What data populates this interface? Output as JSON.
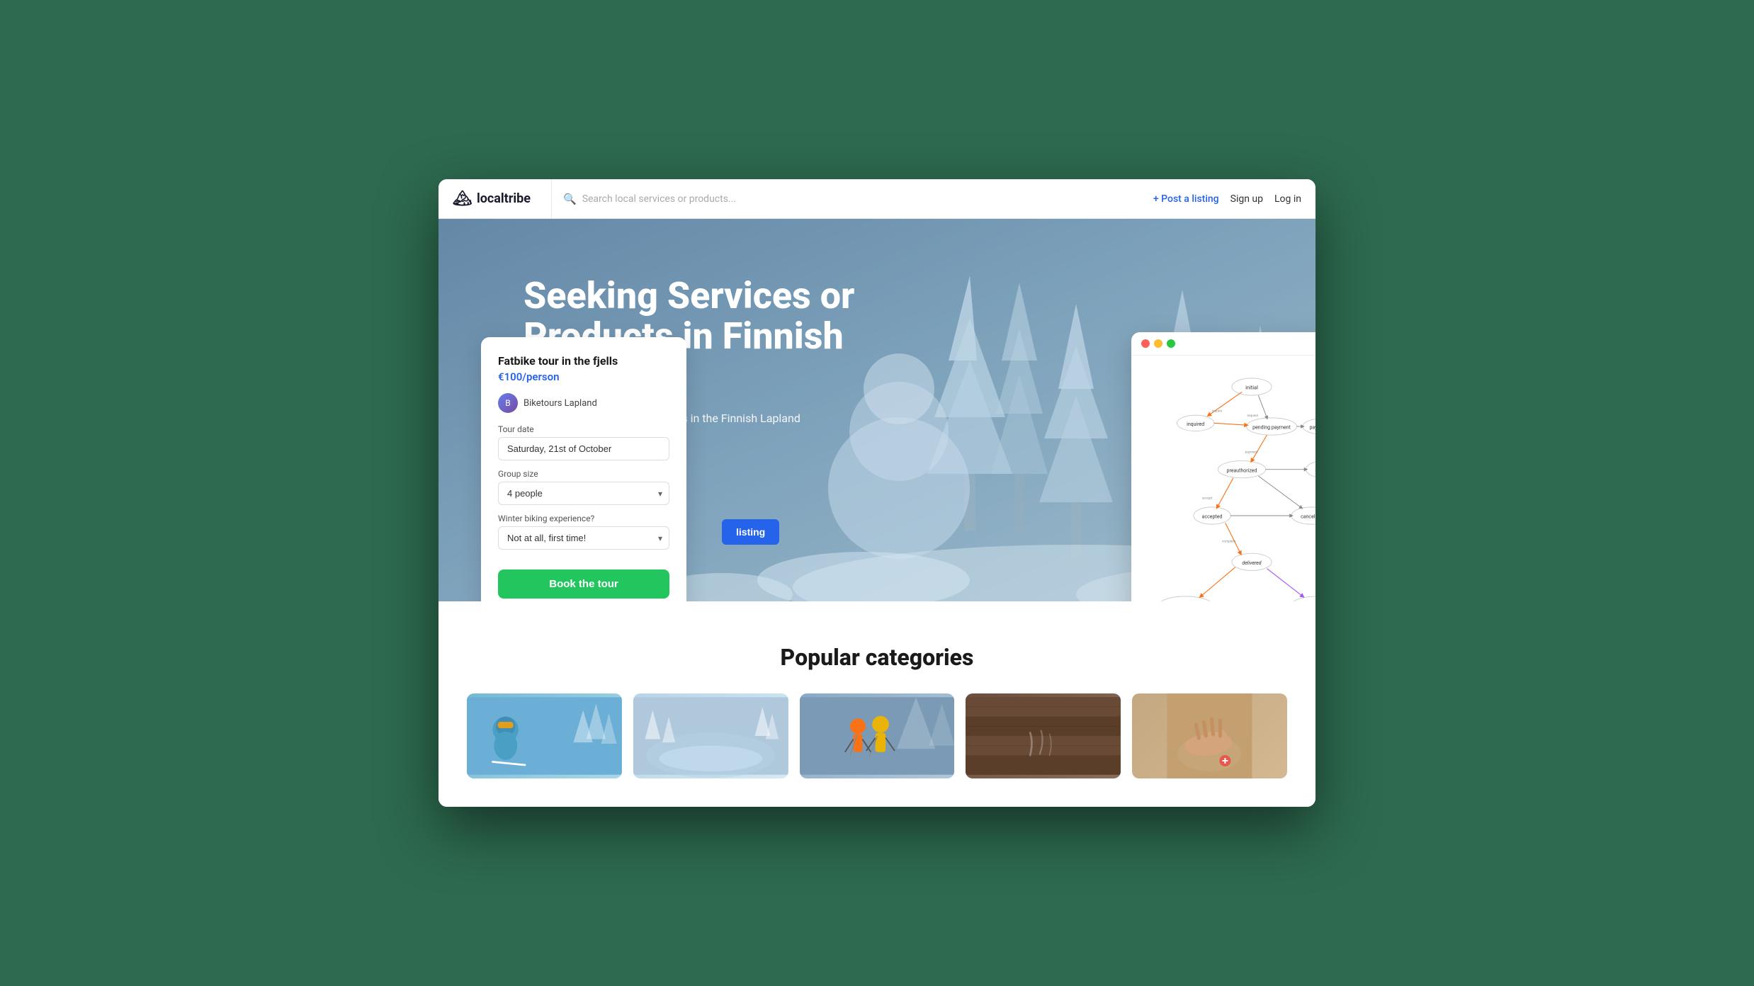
{
  "navbar": {
    "logo_icon": "🏔",
    "logo_text": "localtribe",
    "search_placeholder": "Search local services or products...",
    "post_listing_label": "+ Post a listing",
    "signup_label": "Sign up",
    "login_label": "Log in"
  },
  "hero": {
    "title": "Seeking Services or Products in Finnish Lapland?",
    "subtitle": "Connect with local professionals in the Finnish Lapland"
  },
  "booking_card": {
    "title": "Fatbike tour in the fjells",
    "price": "€100/person",
    "provider": "Biketours Lapland",
    "tour_date_label": "Tour date",
    "tour_date_value": "Saturday, 21st of October",
    "group_size_label": "Group size",
    "group_size_value": "4 people",
    "experience_label": "Winter biking experience?",
    "experience_value": "Not at all, first time!",
    "book_button_label": "Book the tour"
  },
  "categories_section": {
    "title": "Popular categories"
  },
  "hero_cta": {
    "post_listing_label": "listing"
  }
}
